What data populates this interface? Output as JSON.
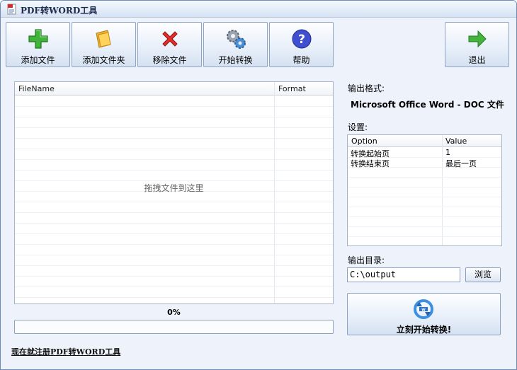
{
  "window": {
    "title": "PDF转WORD工具"
  },
  "toolbar": {
    "add_file": "添加文件",
    "add_folder": "添加文件夹",
    "remove_file": "移除文件",
    "start_convert": "开始转换",
    "help": "帮助",
    "exit": "退出"
  },
  "file_list": {
    "columns": [
      "FileName",
      "Format"
    ],
    "drop_hint": "拖拽文件到这里"
  },
  "progress": {
    "percent_text": "0%",
    "value": 0
  },
  "register_link": "现在就注册PDF转WORD工具",
  "output": {
    "format_label": "输出格式:",
    "format_value": "Microsoft Office Word - DOC 文件",
    "settings_label": "设置:",
    "settings_columns": [
      "Option",
      "Value"
    ],
    "settings_rows": [
      {
        "option": "转换起始页",
        "value": "1"
      },
      {
        "option": "转换结束页",
        "value": "最后一页"
      }
    ],
    "dir_label": "输出目录:",
    "dir_value": "C:\\output",
    "browse": "浏览",
    "start_now": "立刻开始转换!"
  },
  "colors": {
    "accent": "#4aa3f0",
    "window_bg": "#eef3fb",
    "border": "#6f8bb8"
  },
  "icons": [
    "app-icon",
    "add-icon",
    "folder-icon",
    "remove-icon",
    "gears-icon",
    "help-icon",
    "exit-arrow-icon",
    "convert-icon"
  ]
}
